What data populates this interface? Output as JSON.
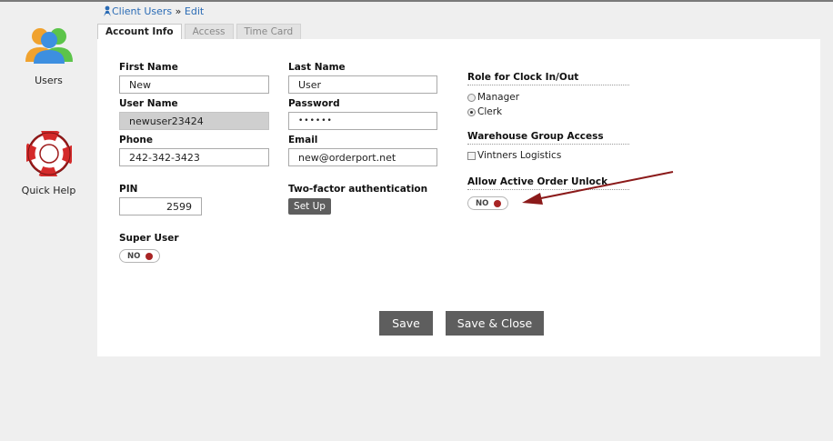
{
  "nav": {
    "users_label": "Users",
    "help_label": "Quick Help",
    "users_icon": "users-icon",
    "help_icon": "lifebuoy-icon"
  },
  "breadcrumb": {
    "link": "Client Users",
    "separator": " » ",
    "current": "Edit"
  },
  "tabs": [
    {
      "label": "Account Info",
      "active": true
    },
    {
      "label": "Access",
      "active": false
    },
    {
      "label": "Time Card",
      "active": false
    }
  ],
  "form": {
    "first_name": {
      "label": "First Name",
      "value": "New"
    },
    "last_name": {
      "label": "Last Name",
      "value": "User"
    },
    "user_name": {
      "label": "User Name",
      "value": "newuser23424"
    },
    "password": {
      "label": "Password",
      "value": "••••••"
    },
    "phone": {
      "label": "Phone",
      "value": "242-342-3423"
    },
    "email": {
      "label": "Email",
      "value": "new@orderport.net"
    },
    "pin": {
      "label": "PIN",
      "value": "2599"
    },
    "two_factor": {
      "label": "Two-factor authentication",
      "button": "Set Up"
    },
    "super_user": {
      "label": "Super User",
      "toggle": "NO"
    }
  },
  "right": {
    "role_title": "Role for Clock In/Out",
    "roles": [
      {
        "label": "Manager",
        "selected": false
      },
      {
        "label": "Clerk",
        "selected": true
      }
    ],
    "warehouse_title": "Warehouse Group Access",
    "warehouse_option": "Vintners Logistics",
    "unlock_title": "Allow Active Order Unlock",
    "unlock_toggle": "NO"
  },
  "actions": {
    "save": "Save",
    "save_close": "Save & Close"
  },
  "colors": {
    "toggle_off_knob": "#a82424",
    "annotation_arrow": "#8b1a1a",
    "link": "#2a6bb5",
    "button": "#5e5e5e"
  }
}
